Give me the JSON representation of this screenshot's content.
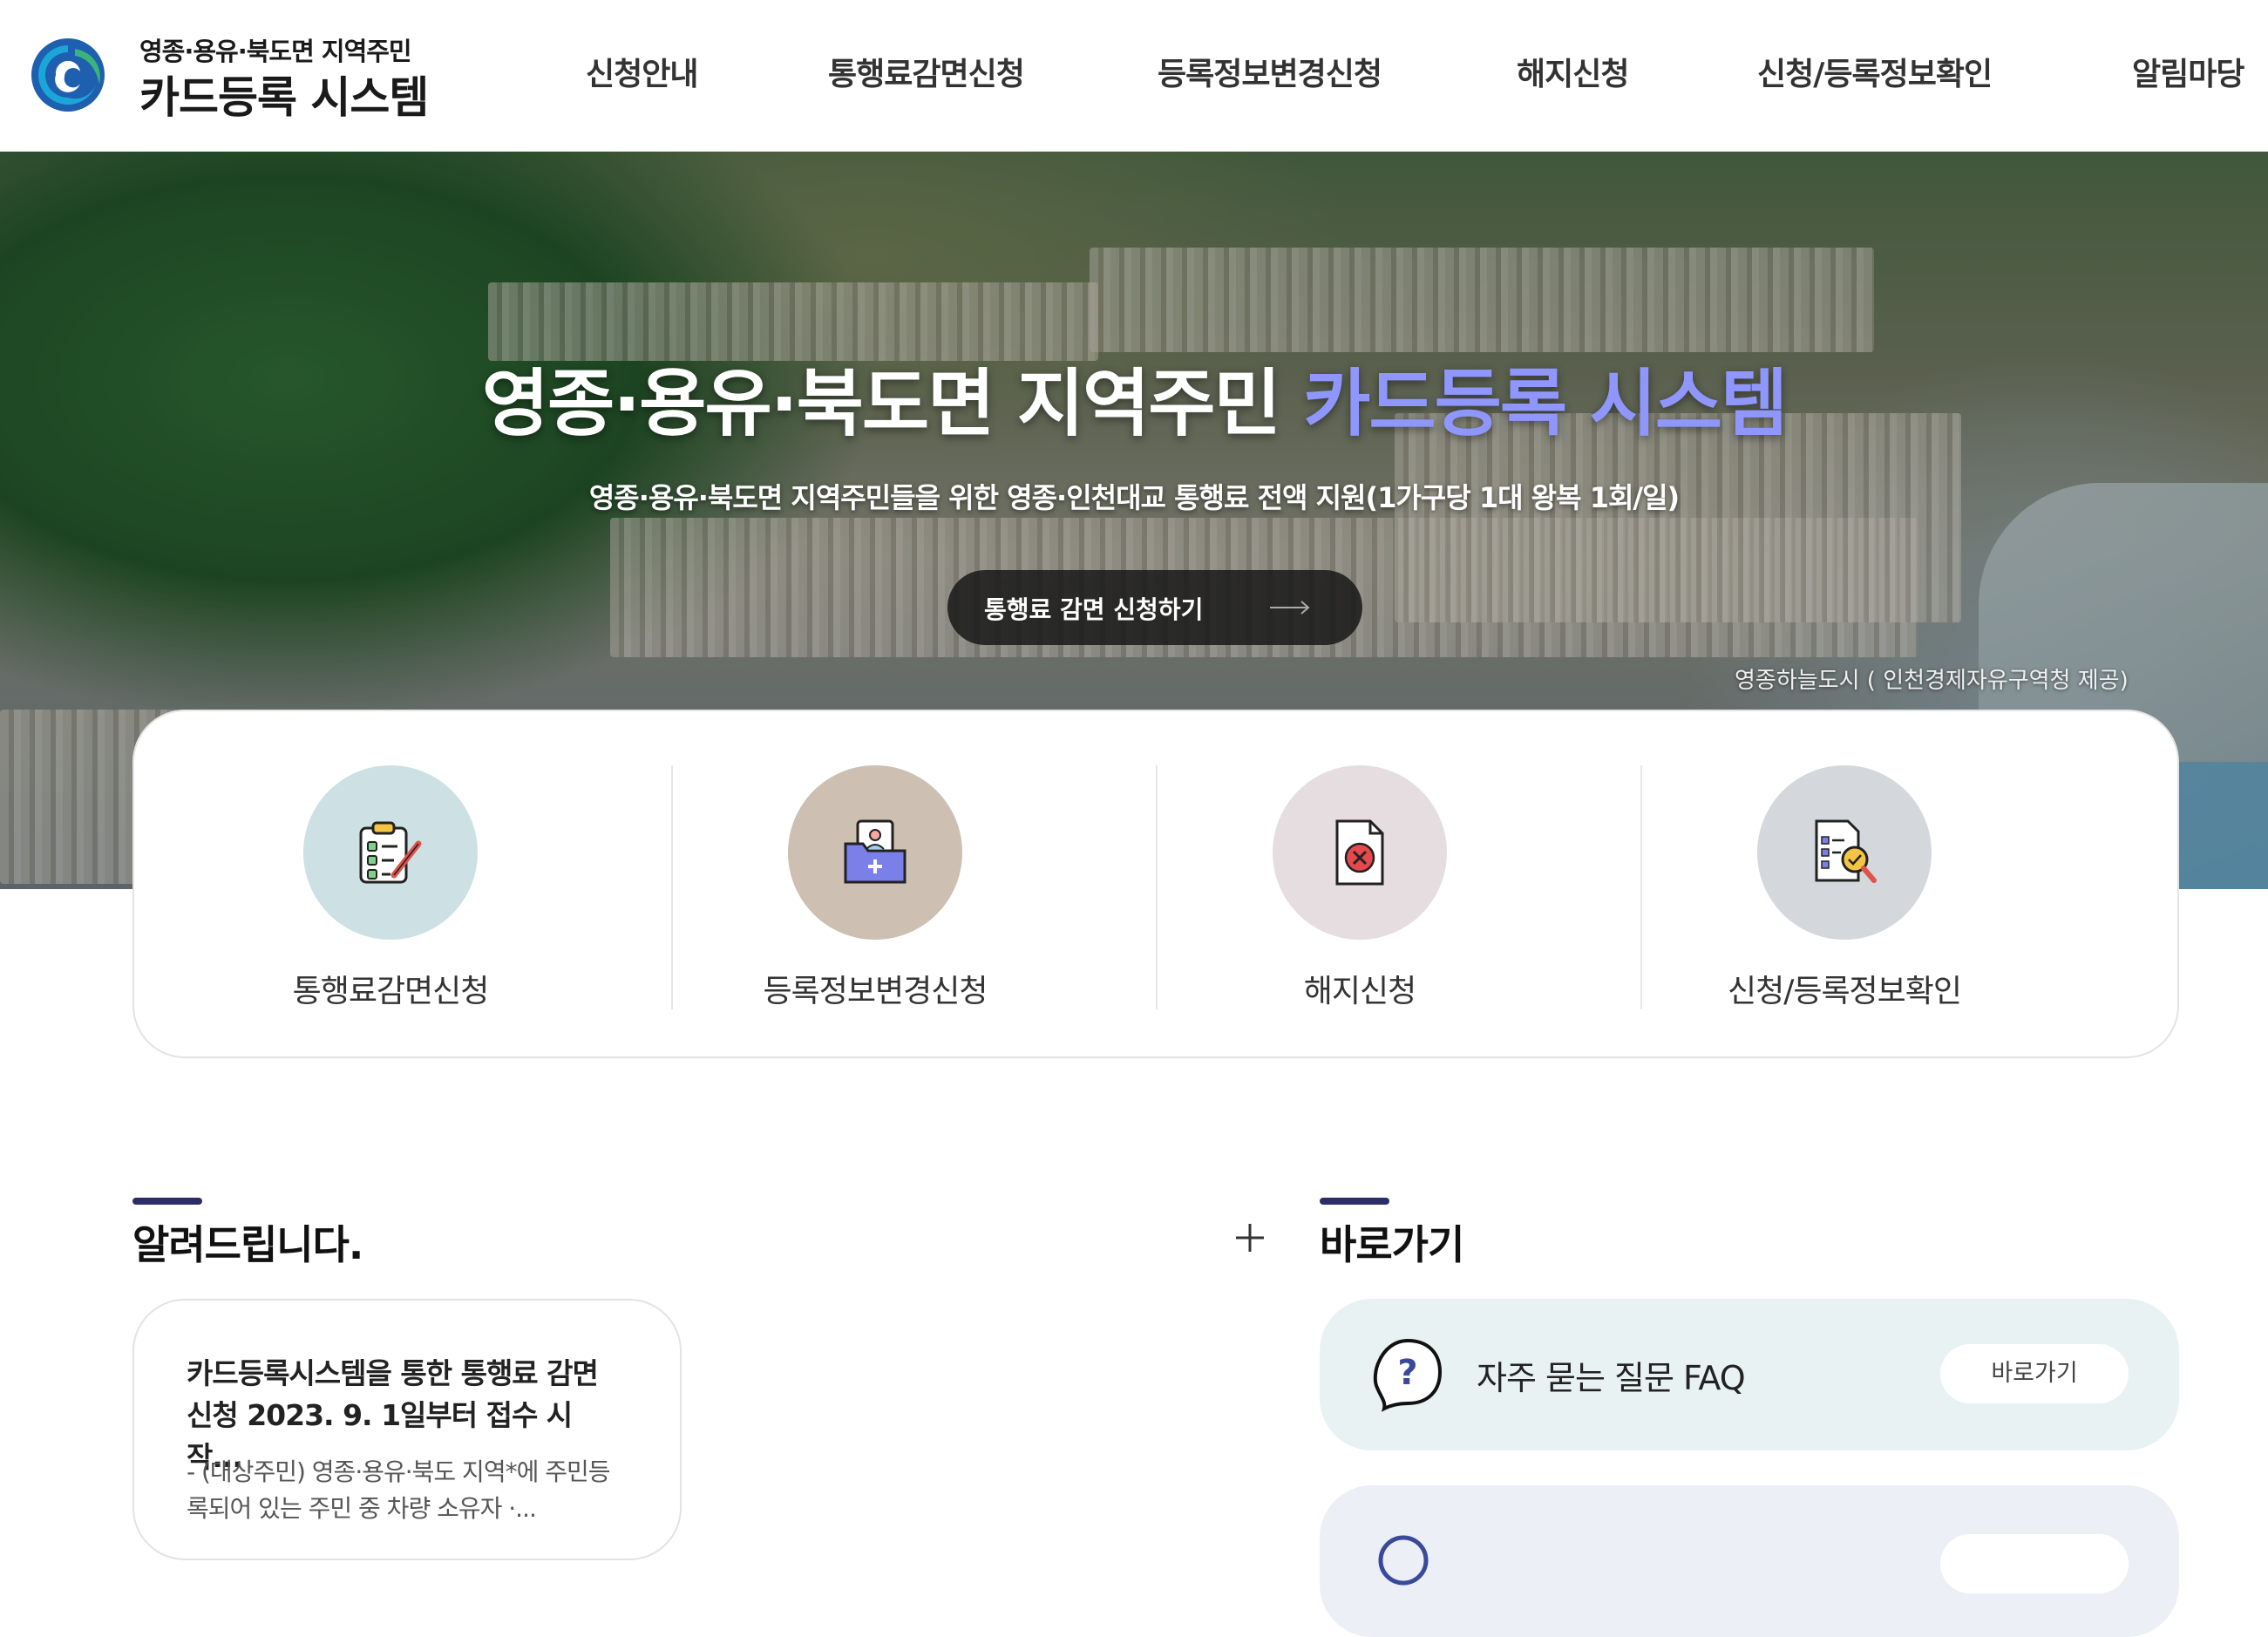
{
  "header": {
    "logo_sub": "영종·용유·북도면 지역주민",
    "logo_main": "카드등록 시스템",
    "nav": [
      "신청안내",
      "통행료감면신청",
      "등록정보변경신청",
      "해지신청",
      "신청/등록정보확인",
      "알림마당"
    ]
  },
  "hero": {
    "title_main": "영종·용유·북도면 지역주민 ",
    "title_accent": "카드등록 시스템",
    "subtitle": "영종·용유·북도면 지역주민들을 위한 영종·인천대교 통행료 전액 지원(1가구당 1대 왕복 1회/일)",
    "cta_label": "통행료 감면 신청하기",
    "credit": "영종하늘도시 ( 인천경제자유구역청 제공)"
  },
  "quick": [
    {
      "label": "통행료감면신청",
      "icon": "clipboard-check-icon",
      "color": "#cde0e3"
    },
    {
      "label": "등록정보변경신청",
      "icon": "folder-person-icon",
      "color": "#cdbfb2"
    },
    {
      "label": "해지신청",
      "icon": "document-cancel-icon",
      "color": "#e6dde0"
    },
    {
      "label": "신청/등록정보확인",
      "icon": "document-search-icon",
      "color": "#d4d8dc"
    }
  ],
  "notice": {
    "section_title": "알려드립니다.",
    "title": "카드등록시스템을 통한 통행료 감면 신청 2023. 9. 1일부터 접수 시작...",
    "body": "- (대상주민) 영종·용유·북도 지역*에 주민등록되어 있는 주민 중 차량 소유자 ·..."
  },
  "shortcuts": {
    "section_title": "바로가기",
    "items": [
      {
        "label": "자주 묻는 질문 FAQ",
        "button": "바로가기",
        "icon": "question-bubble-icon",
        "color": "#e8f2f2"
      },
      {
        "label": "",
        "button": "",
        "icon": "search-icon",
        "color": "#eceff6"
      }
    ]
  },
  "colors": {
    "accent": "#8f97ff",
    "section_bar": "#2b2d6b"
  }
}
